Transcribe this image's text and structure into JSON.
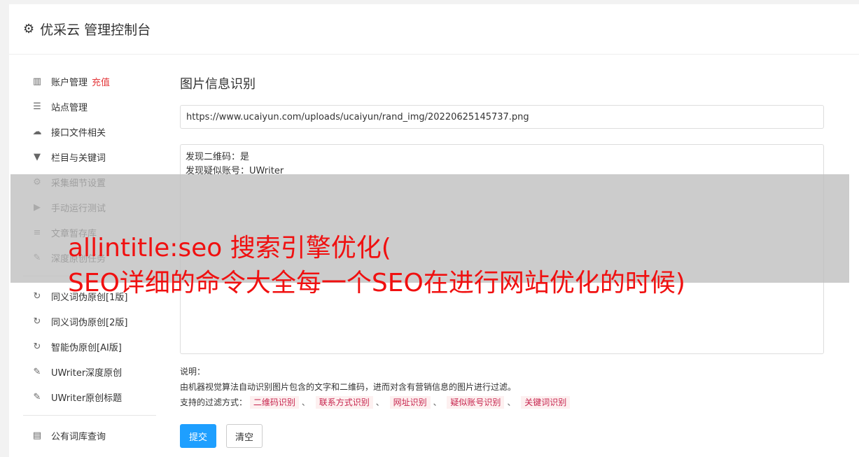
{
  "header": {
    "title": "优采云 管理控制台",
    "icon": "gear-icon"
  },
  "sidebar": {
    "items": [
      {
        "label": "账户管理",
        "badge": "充值",
        "icon": "bar-chart-icon",
        "glyph": "▥"
      },
      {
        "label": "站点管理",
        "icon": "server-icon",
        "glyph": "☰"
      },
      {
        "label": "接口文件相关",
        "icon": "cloud-upload-icon",
        "glyph": "☁"
      },
      {
        "label": "栏目与关键词",
        "icon": "filter-icon",
        "glyph": "▼"
      },
      {
        "label": "采集细节设置",
        "icon": "gears-icon",
        "glyph": "⚙"
      },
      {
        "label": "手动运行测试",
        "icon": "play-circle-icon",
        "glyph": "▶"
      },
      {
        "label": "文章暂存库",
        "icon": "database-icon",
        "glyph": "≡"
      },
      {
        "label": "深度原创任务",
        "icon": "edit-icon",
        "glyph": "✎"
      }
    ],
    "items2": [
      {
        "label": "同义词伪原创[1版]",
        "icon": "refresh-icon",
        "glyph": "↻"
      },
      {
        "label": "同义词伪原创[2版]",
        "icon": "refresh-icon",
        "glyph": "↻"
      },
      {
        "label": "智能伪原创[AI版]",
        "icon": "refresh-icon",
        "glyph": "↻"
      },
      {
        "label": "UWriter深度原创",
        "icon": "edit-icon",
        "glyph": "✎"
      },
      {
        "label": "UWriter原创标题",
        "icon": "edit-icon",
        "glyph": "✎"
      }
    ],
    "items3": [
      {
        "label": "公有词库查询",
        "icon": "book-icon",
        "glyph": "▤"
      }
    ]
  },
  "main": {
    "title": "图片信息识别",
    "url_value": "https://www.ucaiyun.com/uploads/ucaiyun/rand_img/20220625145737.png",
    "result_lines": [
      "发现二维码：是",
      "发现疑似账号：UWriter"
    ],
    "notes_label": "说明：",
    "notes_text": "由机器视觉算法自动识别图片包含的文字和二维码，进而对含有营销信息的图片进行过滤。",
    "filter_label": "支持的过滤方式：",
    "filter_tags": [
      "二维码识别",
      "联系方式识别",
      "网址识别",
      "疑似账号识别",
      "关键词识别"
    ],
    "separator": "、",
    "submit_label": "提交",
    "clear_label": "清空"
  },
  "overlay": {
    "line1": "allintitle:seo 搜索引擎优化(",
    "line2": "SEO详细的命令大全每一个SEO在进行网站优化的时候)"
  }
}
